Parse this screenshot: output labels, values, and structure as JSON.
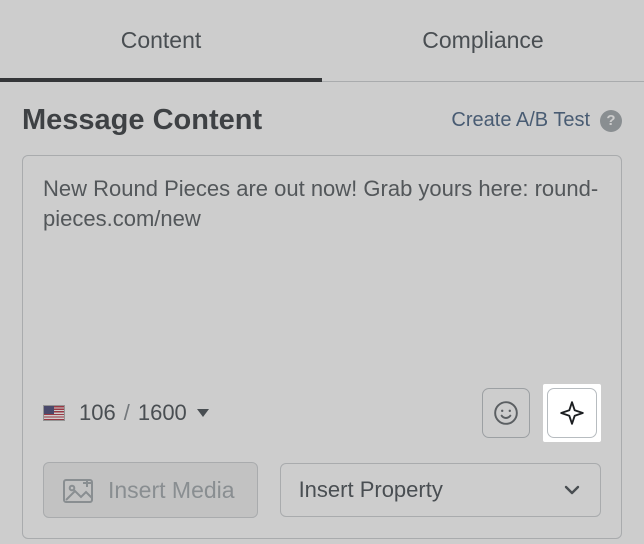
{
  "tabs": {
    "content": "Content",
    "compliance": "Compliance",
    "active": "content"
  },
  "header": {
    "title": "Message Content",
    "ab_link": "Create A/B Test",
    "help_symbol": "?"
  },
  "editor": {
    "message": "New Round Pieces are out now! Grab yours here: round-pieces.com/new",
    "char_count": "106",
    "char_limit_separator": "/",
    "char_limit": "1600",
    "locale": "en-US"
  },
  "actions": {
    "insert_media": "Insert Media",
    "insert_property": "Insert Property"
  }
}
